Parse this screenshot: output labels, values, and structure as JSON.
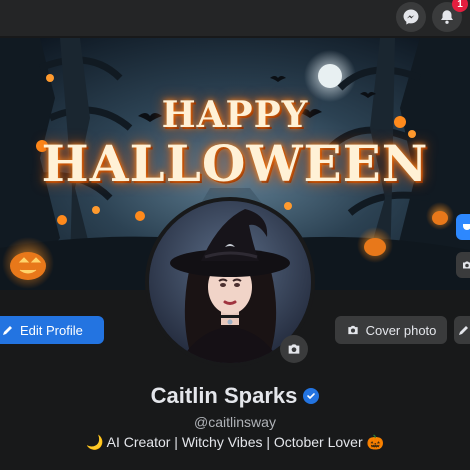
{
  "topbar": {
    "messenger_icon": "messenger-icon",
    "bell_icon": "bell-icon",
    "notification_count": "1"
  },
  "cover": {
    "title_line1": "HAPPY",
    "title_line2": "HALLOWEEN"
  },
  "profile": {
    "name": "Caitlin Sparks",
    "handle": "@caitlinsway",
    "bio": "🌙 AI Creator | Witchy Vibes | October Lover 🎃",
    "verified": true
  },
  "actions": {
    "edit_profile_label": "Edit Profile",
    "cover_photo_label": "Cover photo"
  },
  "colors": {
    "background": "#18191a",
    "accent": "#2374e1",
    "badge": "#e41e3f",
    "button": "#3a3b3c"
  }
}
